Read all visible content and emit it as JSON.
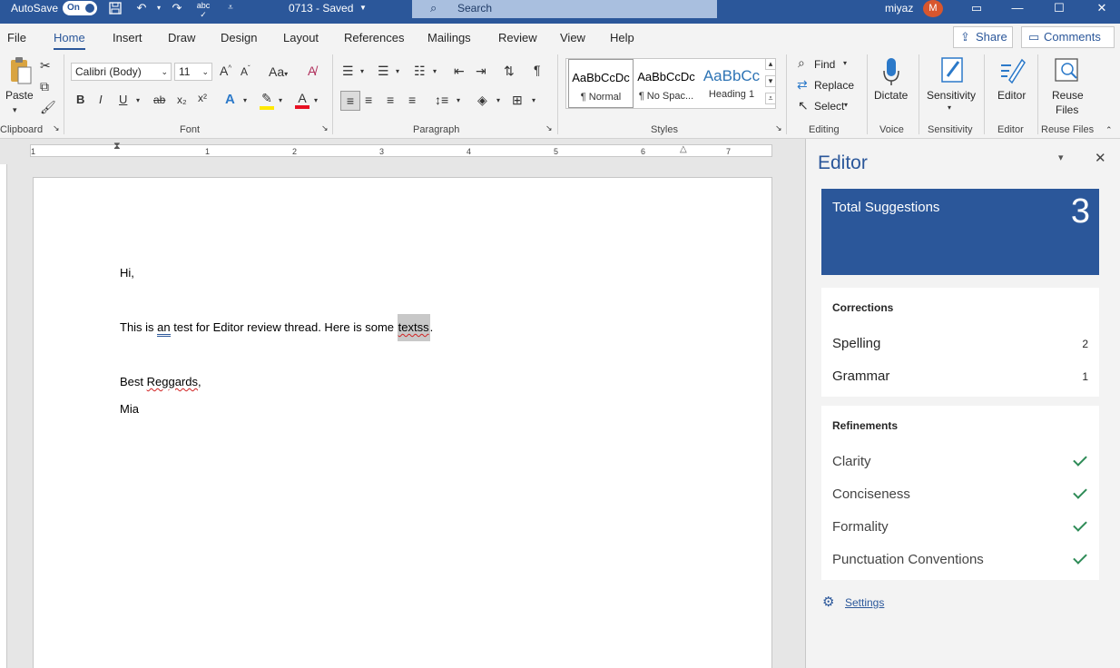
{
  "titlebar": {
    "autosave_label": "AutoSave",
    "autosave_state": "On",
    "doc_title": "0713  -  Saved",
    "search_placeholder": "Search",
    "user_name": "miyaz",
    "user_initial": "M",
    "spelling_icon_text": "abc"
  },
  "menu": {
    "tabs": [
      "File",
      "Home",
      "Insert",
      "Draw",
      "Design",
      "Layout",
      "References",
      "Mailings",
      "Review",
      "View",
      "Help"
    ],
    "active_tab": "Home",
    "share_label": "Share",
    "comments_label": "Comments"
  },
  "ribbon": {
    "clipboard": {
      "paste_label": "Paste",
      "group_label": "Clipboard"
    },
    "font": {
      "font_name": "Calibri (Body)",
      "font_size": "11",
      "group_label": "Font",
      "bold": "B",
      "italic": "I",
      "underline": "U",
      "strike": "ab",
      "subscript": "x₂",
      "superscript": "x²",
      "grow": "A",
      "shrink": "A",
      "case": "Aa",
      "text_effects": "A",
      "font_color": "A"
    },
    "paragraph": {
      "group_label": "Paragraph",
      "pilcrow": "¶"
    },
    "styles": {
      "group_label": "Styles",
      "items": [
        {
          "preview": "AaBbCcDc",
          "name": "¶ Normal"
        },
        {
          "preview": "AaBbCcDc",
          "name": "¶ No Spac..."
        },
        {
          "preview": "AaBbCc",
          "name": "Heading 1"
        }
      ]
    },
    "editing": {
      "find": "Find",
      "replace": "Replace",
      "select": "Select",
      "group_label": "Editing"
    },
    "voice": {
      "dictate": "Dictate",
      "group_label": "Voice"
    },
    "sensitivity": {
      "label": "Sensitivity",
      "group_label": "Sensitivity"
    },
    "editor": {
      "label": "Editor",
      "group_label": "Editor"
    },
    "reuse": {
      "label_line1": "Reuse",
      "label_line2": "Files",
      "group_label": "Reuse Files"
    }
  },
  "ruler": {
    "marks": [
      "1",
      "1",
      "2",
      "3",
      "4",
      "5",
      "6",
      "7"
    ]
  },
  "document": {
    "greeting": "Hi,",
    "body_before": "This is ",
    "body_grammar": "an",
    "body_middle": " test for Editor review thread. Here is some ",
    "body_spelling": "textss",
    "body_end": ".",
    "closing_prefix": "Best ",
    "closing_misspelled": "Reggards",
    "closing_end": ",",
    "signature": "Mia"
  },
  "editor_pane": {
    "title": "Editor",
    "total_label": "Total Suggestions",
    "total_count": "3",
    "corrections": {
      "heading": "Corrections",
      "items": [
        {
          "label": "Spelling",
          "count": "2"
        },
        {
          "label": "Grammar",
          "count": "1"
        }
      ]
    },
    "refinements": {
      "heading": "Refinements",
      "items": [
        "Clarity",
        "Conciseness",
        "Formality",
        "Punctuation Conventions"
      ]
    },
    "settings_label": "Settings",
    "accent": "#2b579a",
    "check_color": "#2e8b57"
  }
}
